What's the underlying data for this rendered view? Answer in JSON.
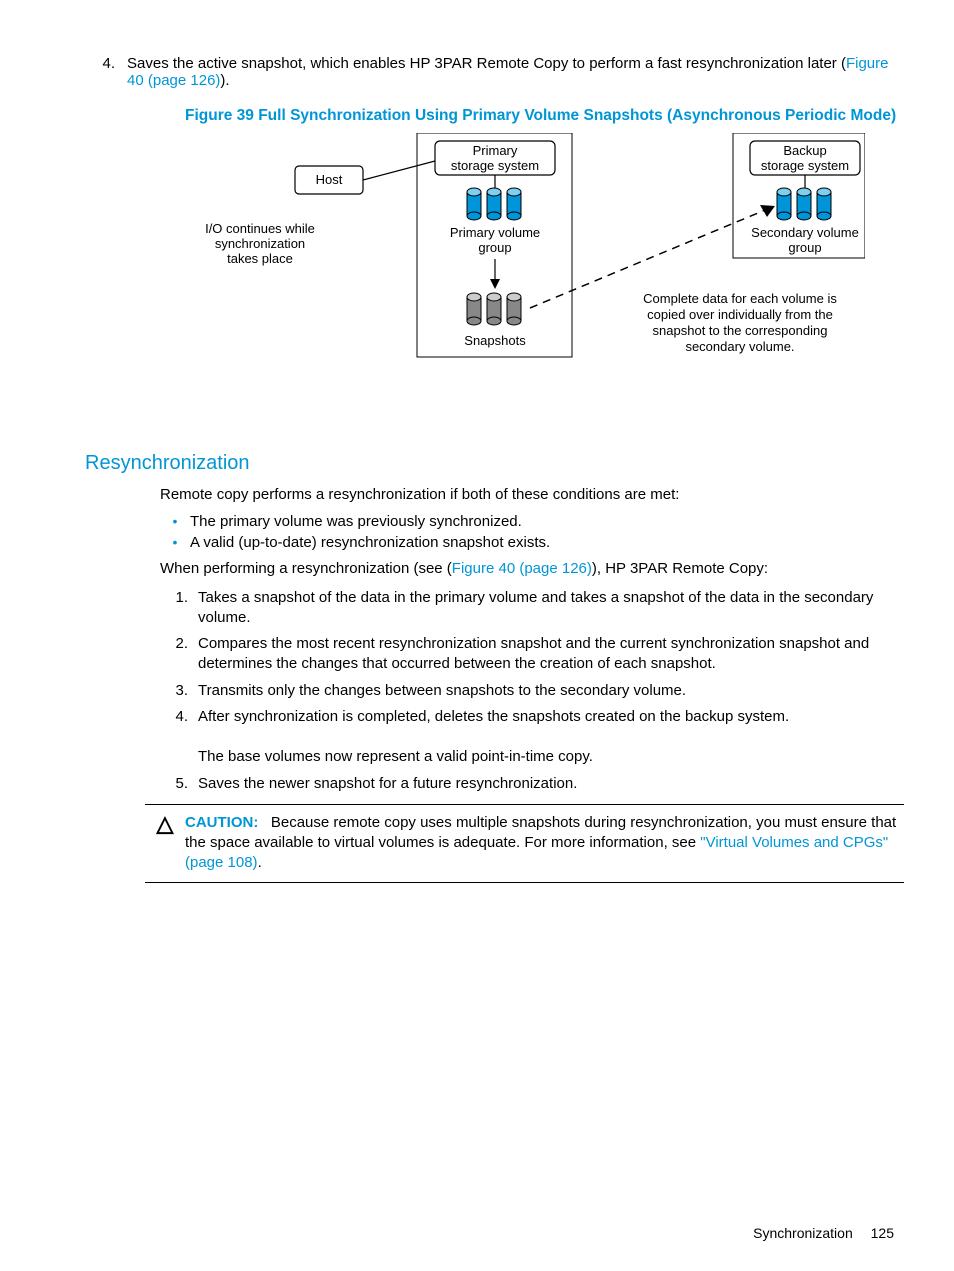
{
  "topItem": {
    "num": "4.",
    "text_a": "Saves the active snapshot, which enables HP 3PAR Remote Copy to perform a fast resynchronization later (",
    "link": "Figure 40 (page 126)",
    "text_b": ")."
  },
  "figureTitle": "Figure 39 Full Synchronization Using Primary Volume Snapshots (Asynchronous Periodic Mode)",
  "fig": {
    "host": "Host",
    "primary1": "Primary",
    "primary2": "storage system",
    "backup1": "Backup",
    "backup2": "storage system",
    "side1": "I/O continues while",
    "side2": "synchronization",
    "side3": "takes place",
    "pvg1": "Primary volume",
    "pvg2": "group",
    "svg1": "Secondary volume",
    "svg2": "group",
    "snap": "Snapshots",
    "note1": "Complete data for each volume is",
    "note2": "copied over individually from the",
    "note3": "snapshot to the corresponding",
    "note4": "secondary volume."
  },
  "sectionHeading": "Resynchronization",
  "p1": "Remote copy performs a resynchronization if both of these conditions are met:",
  "bullets": [
    "The primary volume was previously synchronized.",
    "A valid (up-to-date) resynchronization snapshot exists."
  ],
  "p2a": "When performing a resynchronization (see (",
  "p2link": "Figure 40 (page 126)",
  "p2b": "), HP 3PAR Remote Copy:",
  "steps": [
    {
      "n": "1.",
      "t": "Takes a snapshot of the data in the primary volume and takes a snapshot of the data in the secondary volume."
    },
    {
      "n": "2.",
      "t": "Compares the most recent resynchronization snapshot and the current synchronization snapshot and determines the changes that occurred between the creation of each snapshot."
    },
    {
      "n": "3.",
      "t": "Transmits only the changes between snapshots to the secondary volume."
    },
    {
      "n": "4.",
      "t": "After synchronization is completed, deletes the snapshots created on the backup system.",
      "t2": "The base volumes now represent a valid point-in-time copy."
    },
    {
      "n": "5.",
      "t": "Saves the newer snapshot for a future resynchronization."
    }
  ],
  "caution": {
    "label": "CAUTION:",
    "text_a": "Because remote copy uses multiple snapshots during resynchronization, you must ensure that the space available to virtual volumes is adequate. For more information, see ",
    "link": "\"Virtual Volumes and CPGs\" (page 108)",
    "text_b": "."
  },
  "footer": {
    "section": "Synchronization",
    "page": "125"
  }
}
